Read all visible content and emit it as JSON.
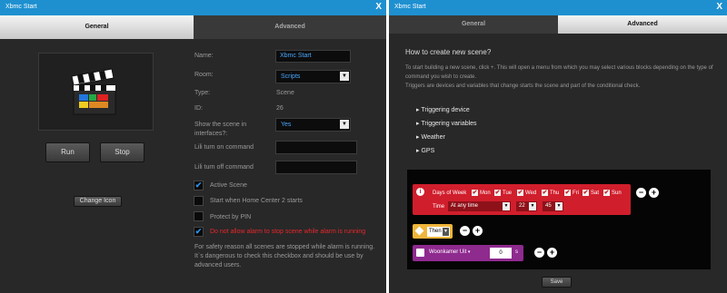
{
  "left": {
    "title": "Xbmc Start",
    "close": "X",
    "tabs": [
      "General",
      "Advanced"
    ],
    "run": "Run",
    "stop": "Stop",
    "change_icon": "Change Icon",
    "fields": {
      "name_label": "Name:",
      "name_value": "Xbmc Start",
      "room_label": "Room:",
      "room_value": "Scripts",
      "type_label": "Type:",
      "type_value": "Scene",
      "id_label": "ID:",
      "id_value": "26",
      "show_label": "Show the scene in interfaces?:",
      "show_value": "Yes",
      "lili_on_label": "Lili turn on command",
      "lili_off_label": "Lili turn off command"
    },
    "checks": [
      {
        "label": "Active Scene",
        "checked": true
      },
      {
        "label": "Start when Home Center 2 starts",
        "checked": false
      },
      {
        "label": "Protect by PIN",
        "checked": false
      },
      {
        "label": "Do not allow alarm to stop scene while alarm is running",
        "checked": true
      }
    ],
    "note": "For safety reason all scenes are stopped while alarm is running. It`s dangerous to check this checkbox and should be use by advanced users."
  },
  "right": {
    "title": "Xbmc Start",
    "close": "X",
    "tabs": [
      "General",
      "Advanced"
    ],
    "heading": "How to create new scene?",
    "para1": "To start building a new scene, click +. This will open a menu from which you may select various blocks depending on the type of command you wish to create.",
    "para2": "Triggers are devices and variables that change starts the scene and part of the conditional check.",
    "bullets": [
      "Triggering device",
      "Triggering variables",
      "Weather",
      "GPS"
    ],
    "days_label": "Days of Week",
    "days": [
      "Mon",
      "Tue",
      "Wed",
      "Thu",
      "Fri",
      "Sat",
      "Sun"
    ],
    "time_label": "Time",
    "time_value": "At any time",
    "hour": "22",
    "minute": "45",
    "then": "Then",
    "device": "Woonkamer Uit",
    "delay": "0",
    "unit": "s",
    "save": "Save",
    "colors": {
      "red": "#d01e2c",
      "yellow": "#f0b63a",
      "purple": "#8f2a8f"
    }
  }
}
